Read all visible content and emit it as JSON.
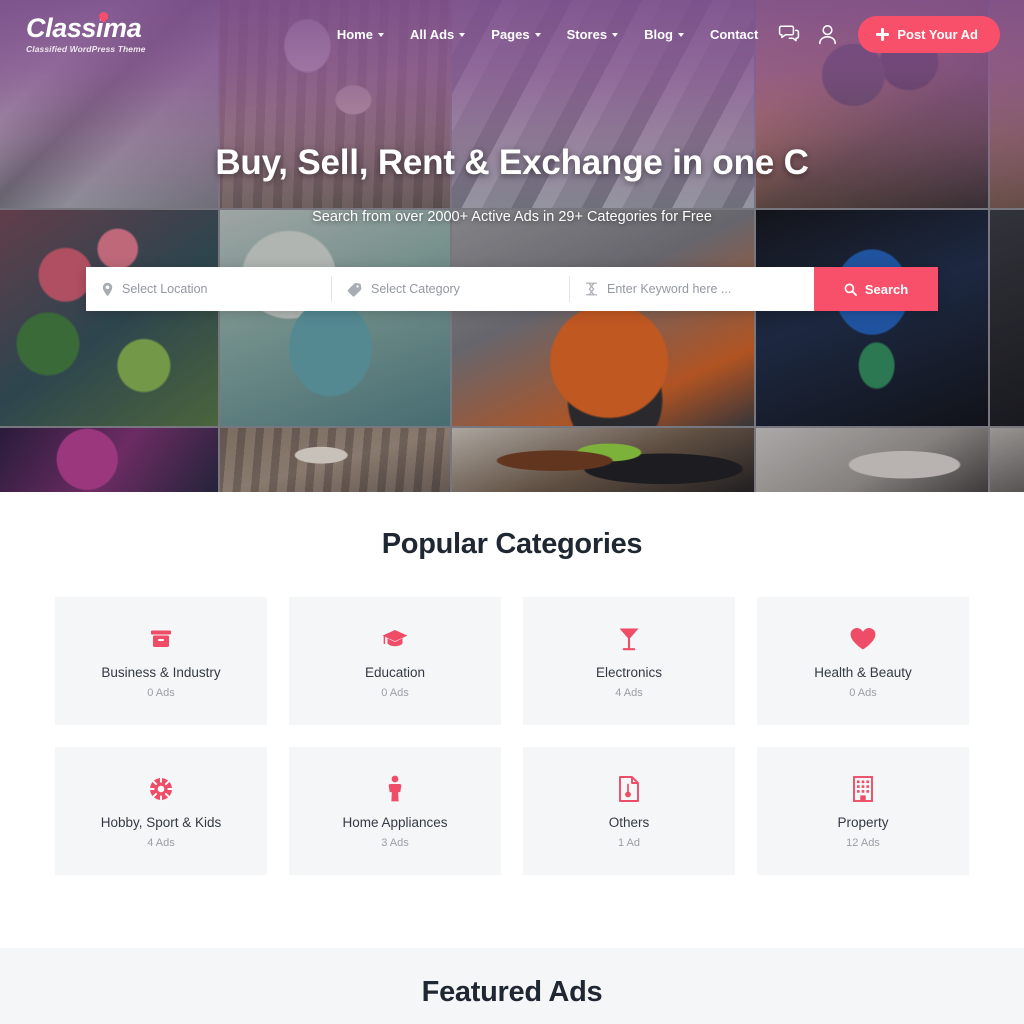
{
  "brand": {
    "name": "Classima",
    "tagline": "Classified WordPress Theme",
    "accent_color": "#f8506b",
    "logo_dot_icon": "location-pin-dot"
  },
  "nav": {
    "items": [
      {
        "label": "Home",
        "has_dropdown": true,
        "icon": "chevron-down-icon"
      },
      {
        "label": "All Ads",
        "has_dropdown": true,
        "icon": "chevron-down-icon"
      },
      {
        "label": "Pages",
        "has_dropdown": true,
        "icon": "chevron-down-icon"
      },
      {
        "label": "Stores",
        "has_dropdown": true,
        "icon": "chevron-down-icon"
      },
      {
        "label": "Blog",
        "has_dropdown": true,
        "icon": "chevron-down-icon"
      },
      {
        "label": "Contact",
        "has_dropdown": false,
        "icon": ""
      }
    ]
  },
  "header_actions": {
    "chat_icon": "chat-bubbles-icon",
    "account_icon": "user-account-icon",
    "post_ad_label": "Post Your Ad",
    "post_ad_icon": "plus-icon"
  },
  "hero": {
    "title": "Buy, Sell, Rent & Exchange in one C",
    "subtitle": "Search from over 2000+ Active Ads in 29+ Categories for Free"
  },
  "search": {
    "location_placeholder": "Select Location",
    "location_icon": "map-pin-icon",
    "category_placeholder": "Select Category",
    "category_icon": "tag-icon",
    "keyword_placeholder": "Enter Keyword here ...",
    "keyword_icon": "text-cursor-icon",
    "button_label": "Search",
    "button_icon": "search-icon",
    "location_value": "",
    "category_value": "",
    "keyword_value": ""
  },
  "categories": {
    "title": "Popular Categories",
    "items": [
      {
        "name": "Business & Industry",
        "count": "0 Ads",
        "icon": "briefcase-box-icon"
      },
      {
        "name": "Education",
        "count": "0 Ads",
        "icon": "graduation-cap-icon"
      },
      {
        "name": "Electronics",
        "count": "4 Ads",
        "icon": "cocktail-glass-icon"
      },
      {
        "name": "Health & Beauty",
        "count": "0 Ads",
        "icon": "heart-icon"
      },
      {
        "name": "Hobby, Sport & Kids",
        "count": "4 Ads",
        "icon": "soccer-ball-icon"
      },
      {
        "name": "Home Appliances",
        "count": "3 Ads",
        "icon": "person-icon"
      },
      {
        "name": "Others",
        "count": "1 Ad",
        "icon": "document-icon"
      },
      {
        "name": "Property",
        "count": "12 Ads",
        "icon": "building-icon"
      }
    ]
  },
  "featured": {
    "title": "Featured Ads"
  }
}
